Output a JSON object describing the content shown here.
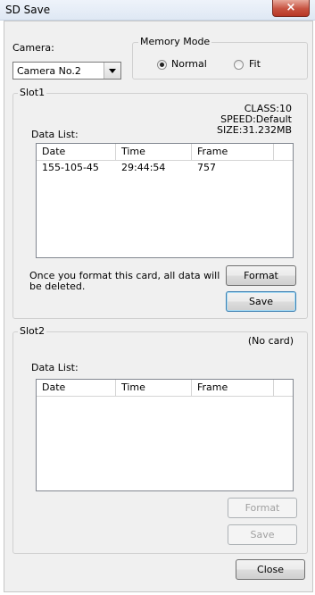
{
  "window": {
    "title": "SD Save",
    "close_glyph": "×"
  },
  "camera": {
    "label": "Camera:",
    "selected": "Camera No.2"
  },
  "memory_mode": {
    "legend": "Memory Mode",
    "options": [
      {
        "label": "Normal",
        "checked": true
      },
      {
        "label": "Fit",
        "checked": false
      }
    ]
  },
  "slot1": {
    "legend": "Slot1",
    "info": {
      "class": "CLASS:10",
      "speed": "SPEED:Default",
      "size": "SIZE:31.232MB"
    },
    "data_list_label": "Data List:",
    "columns": [
      "Date",
      "Time",
      "Frame"
    ],
    "rows": [
      {
        "date": "155-105-45",
        "time": "29:44:54",
        "frame": "757"
      }
    ],
    "format_note_line1": "Once you format this card, all data will",
    "format_note_line2": "be deleted.",
    "format_button": "Format",
    "save_button": "Save"
  },
  "slot2": {
    "legend": "Slot2",
    "status": "(No card)",
    "data_list_label": "Data List:",
    "columns": [
      "Date",
      "Time",
      "Frame"
    ],
    "format_button": "Format",
    "save_button": "Save"
  },
  "close_button": "Close"
}
